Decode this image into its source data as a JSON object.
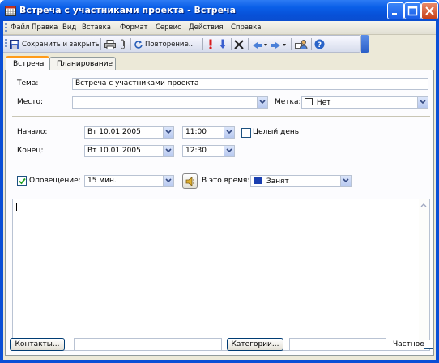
{
  "window": {
    "title": "Встреча с участниками проекта - Встреча"
  },
  "menu": {
    "items": [
      "Файл",
      "Правка",
      "Вид",
      "Вставка",
      "Формат",
      "Сервис",
      "Действия",
      "Справка"
    ]
  },
  "toolbar": {
    "save_close_label": "Сохранить и закрыть",
    "recurrence_label": "Повторение..."
  },
  "tabs": {
    "items": [
      "Встреча",
      "Планирование"
    ],
    "active": "Встреча"
  },
  "form": {
    "subject_label": "Тема:",
    "subject_value": "Встреча с участниками проекта",
    "location_label": "Место:",
    "location_value": "",
    "label_label": "Метка:",
    "label_value": "Нет",
    "start_label": "Начало:",
    "start_date": "Вт 10.01.2005",
    "start_time": "11:00",
    "all_day_label": "Целый день",
    "all_day_checked": false,
    "end_label": "Конец:",
    "end_date": "Вт 10.01.2005",
    "end_time": "12:30",
    "reminder_label": "Оповещение:",
    "reminder_checked": true,
    "reminder_value": "15 мин.",
    "show_as_label": "В это время:",
    "show_as_value": "Занят",
    "show_as_color": "#1a3fb0",
    "notes_value": ""
  },
  "footer": {
    "contacts_button": "Контакты...",
    "contacts_value": "",
    "categories_button": "Категории...",
    "categories_value": "",
    "private_label": "Частное",
    "private_checked": false
  },
  "colors": {
    "titlebar": "#0a5fe8",
    "window_bg": "#ece9d8",
    "tab_highlight": "#ff9b1a"
  },
  "icons": {
    "app": "calendar-icon",
    "print": "printer-icon",
    "attach": "paperclip-icon",
    "recurrence": "recurrence-icon",
    "high_importance": "exclamation-icon",
    "low_importance": "down-arrow-icon",
    "delete": "delete-x-icon",
    "prev": "previous-item-icon",
    "next": "next-item-icon",
    "invite": "invite-attendees-icon",
    "help": "help-icon",
    "sound": "sound-icon"
  }
}
